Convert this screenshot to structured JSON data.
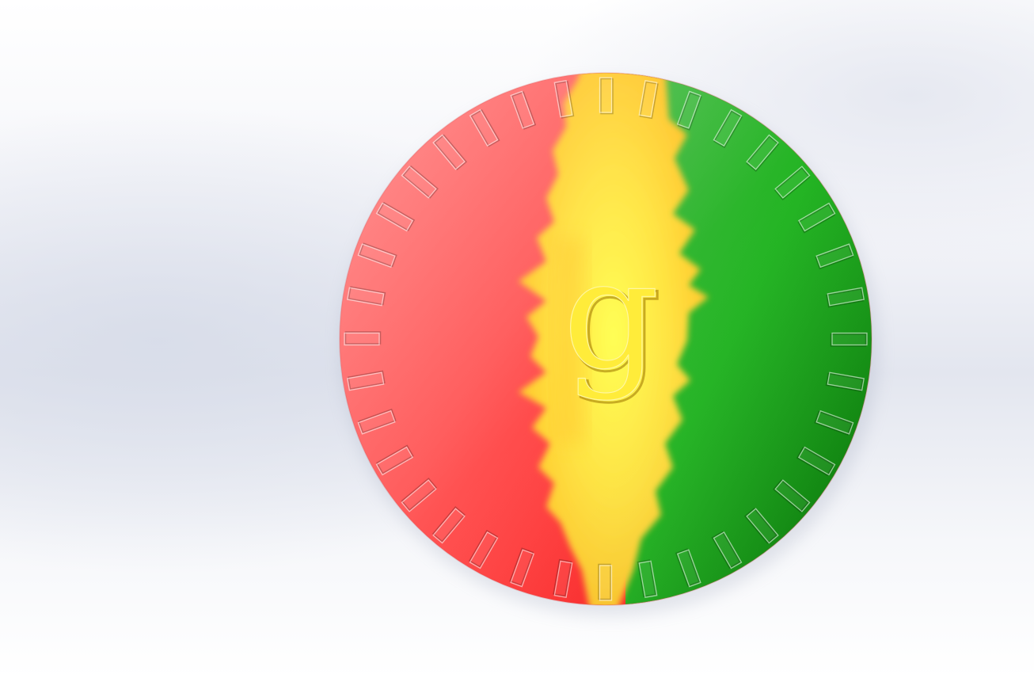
{
  "scene": {
    "center_letter": "g",
    "tick_count": 36,
    "colors": {
      "red": "#ff3a3a",
      "red_light": "#ff7a7a",
      "yellow": "#ffe63a",
      "orange": "#ffc22a",
      "green": "#1fb81f",
      "green_dark": "#007a00",
      "letter_outline": "#c89a10",
      "tick_edge": "#ffffff"
    }
  }
}
